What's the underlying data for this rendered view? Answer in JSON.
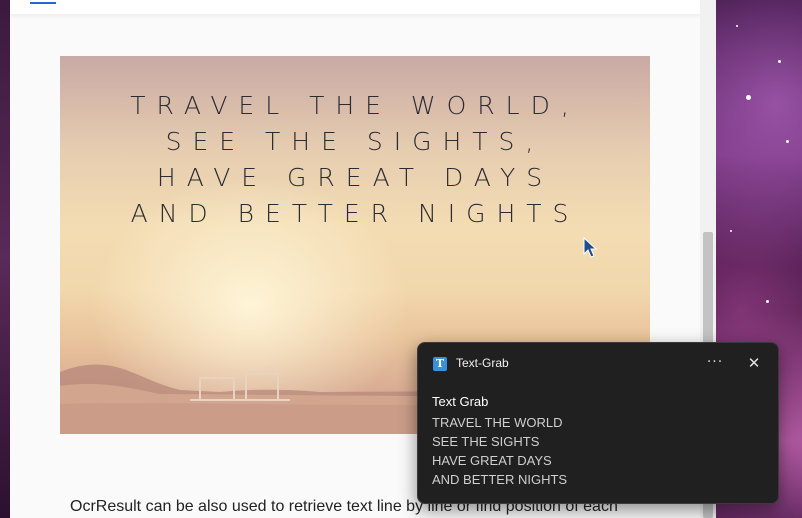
{
  "image": {
    "lines": [
      "TRAVEL THE WORLD,",
      "SEE THE SIGHTS,",
      "HAVE GREAT DAYS",
      "AND BETTER NIGHTS"
    ]
  },
  "article": {
    "text": "OcrResult can be also used to retrieve text line by line or find position of each"
  },
  "notification": {
    "app_name": "Text-Grab",
    "app_icon": "text-grab-icon",
    "more_label": "···",
    "close_label": "✕",
    "title": "Text Grab",
    "lines": [
      "TRAVEL THE WORLD",
      "SEE THE SIGHTS",
      "HAVE GREAT DAYS",
      "AND BETTER NIGHTS"
    ]
  },
  "colors": {
    "toast_bg": "#202020",
    "accent": "#3a8fd8"
  }
}
